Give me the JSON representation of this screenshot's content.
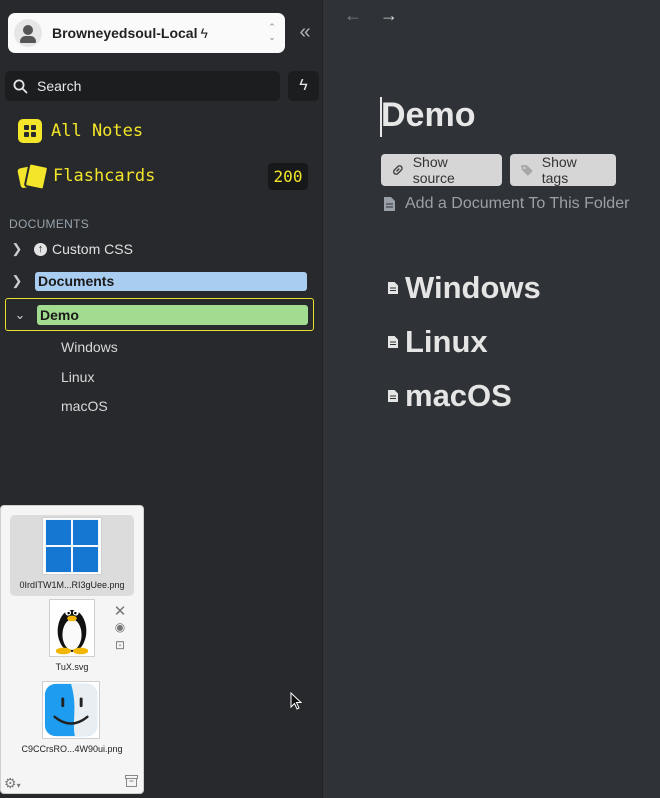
{
  "sidebar": {
    "vault_name": "Browneyedsoul-Local",
    "vault_bolt": "ϟ",
    "search_placeholder": "Search",
    "all_notes_label": "All Notes",
    "flashcards_label": "Flashcards",
    "flashcards_count": "200",
    "section_heading": "DOCUMENTS",
    "tree": {
      "custom_css": "Custom CSS",
      "documents": "Documents",
      "demo": "Demo",
      "children": [
        "Windows",
        "Linux",
        "macOS"
      ]
    },
    "colors": {
      "accent": "#f3e52a",
      "documents_pill": "#a9cdf1",
      "demo_pill": "#a2dc90"
    }
  },
  "attachments": {
    "items": [
      {
        "name": "0IrdITW1M...RI3gUee.png",
        "icon": "windows-logo-icon",
        "selected": true
      },
      {
        "name": "TuX.svg",
        "icon": "tux-penguin-icon"
      },
      {
        "name": "C9CCrsRO...4W90ui.png",
        "icon": "finder-face-icon"
      }
    ]
  },
  "editor": {
    "title": "Demo",
    "show_source_label": "Show source",
    "show_tags_label": "Show tags",
    "add_document_label": "Add a Document To This Folder",
    "entries": [
      "Windows",
      "Linux",
      "macOS"
    ]
  }
}
